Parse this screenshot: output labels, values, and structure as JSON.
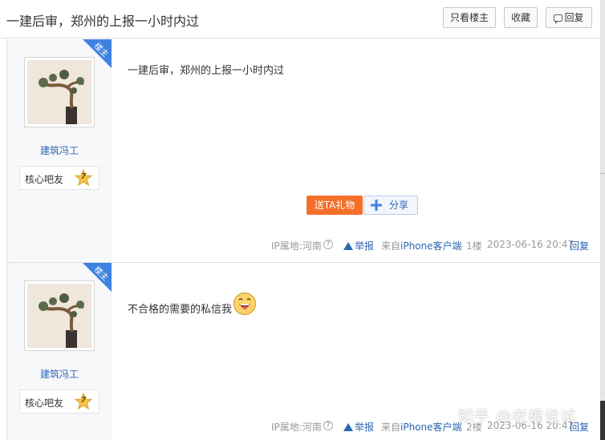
{
  "header": {
    "title": "一建后审，郑州的上报一小时内过",
    "only_owner_label": "只看楼主",
    "favorite_label": "收藏",
    "reply_label": "回复"
  },
  "posts": [
    {
      "corner_badge": "楼主",
      "author": "建筑冯工",
      "badge_label": "核心吧友",
      "badge_level": "7",
      "content": "一建后审，郑州的上报一小时内过",
      "gift_label": "送TA礼物",
      "share_label": "分享",
      "ip": "IP属地:河南",
      "report_label": "举报",
      "from_label": "来自",
      "device": "iPhone客户端",
      "floor": "1楼",
      "time": "2023-06-16 20:47",
      "reply_label": "回复"
    },
    {
      "corner_badge": "楼主",
      "author": "建筑冯工",
      "badge_label": "核心吧友",
      "badge_level": "7",
      "content": "不合格的需要的私信我",
      "ip": "IP属地:河南",
      "report_label": "举报",
      "from_label": "来自",
      "device": "iPhone客户端",
      "floor": "2楼",
      "time": "2023-06-16 20:47",
      "reply_label": "回复"
    }
  ],
  "watermark": "知乎 @老根说试",
  "colors": {
    "link": "#2d64b3",
    "gift": "#f46f2a",
    "corner": "#3d82e1"
  }
}
